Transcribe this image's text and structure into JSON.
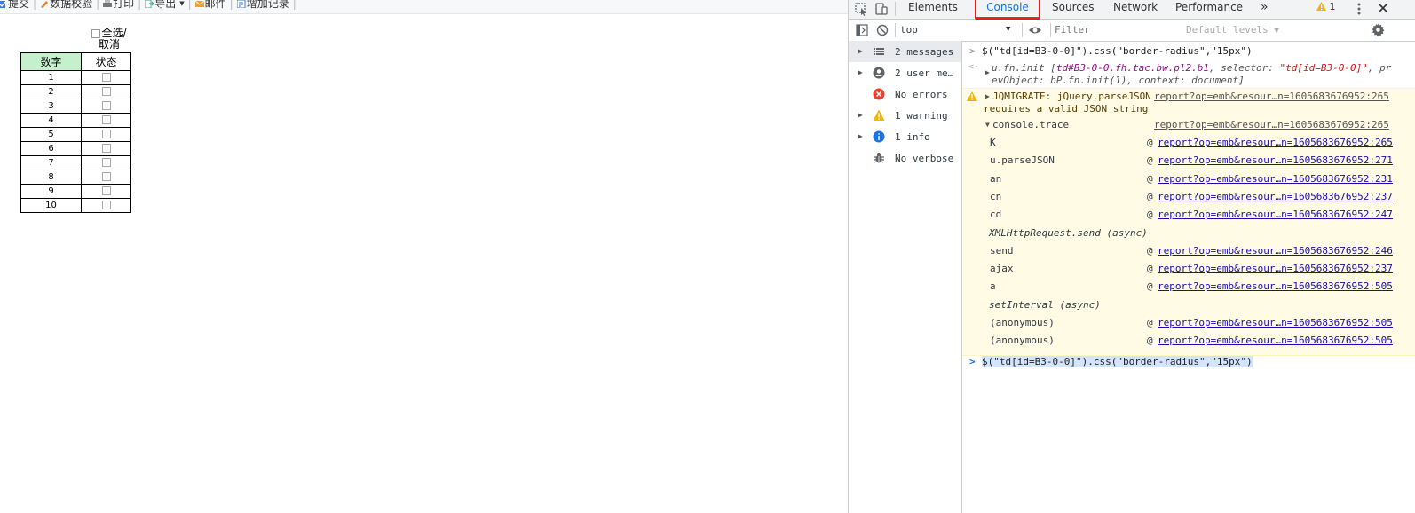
{
  "report": {
    "toolbar": [
      {
        "icon": "submit-icon",
        "label": "提交"
      },
      {
        "icon": "data-check-icon",
        "label": "数据校验"
      },
      {
        "icon": "print-icon",
        "label": "打印"
      },
      {
        "icon": "export-icon",
        "label": "导出"
      },
      {
        "icon": "mail-icon",
        "label": "邮件"
      },
      {
        "icon": "add-record-icon",
        "label": "增加记录"
      }
    ],
    "select_all_line1": "全选/",
    "select_all_line2": "取消",
    "table": {
      "headers": [
        "数字",
        "状态"
      ],
      "rows": [
        "1",
        "2",
        "3",
        "4",
        "5",
        "6",
        "7",
        "8",
        "9",
        "10"
      ]
    },
    "colors": {
      "header_fill": "#c6efce"
    }
  },
  "devtools": {
    "tabs": [
      "Elements",
      "Console",
      "Sources",
      "Network",
      "Performance"
    ],
    "active_tab": "Console",
    "more_tabs_glyph": "»",
    "warning_count": "1",
    "context": "top",
    "filter_placeholder": "Filter",
    "levels": "Default levels",
    "sidebar": [
      {
        "label": "2 messages",
        "icon": "list-icon"
      },
      {
        "label": "2 user me…",
        "icon": "user-icon"
      },
      {
        "label": "No errors",
        "icon": "error-icon"
      },
      {
        "label": "1 warning",
        "icon": "warning-icon"
      },
      {
        "label": "1 info",
        "icon": "info-icon"
      },
      {
        "label": "No verbose",
        "icon": "bug-icon"
      }
    ],
    "log": {
      "cmd1": "$(\"td[id=B3-0-0]\").css(\"border-radius\",\"15px\")",
      "result_line1_a": "u.fn.init [",
      "result_line1_b": "td#B3-0-0.fh.tac.bw.pl2.b1",
      "result_line1_c": ", selector: ",
      "result_line1_d": "\"td[id=B3-0-0]\"",
      "result_line1_e": ", pr",
      "result_line2": "evObject: bP.fn.init(1), context: document]",
      "warn_line1": "JQMIGRATE: jQuery.parseJSON",
      "warn_line2": "requires a valid JSON string",
      "warn_link": "report?op=emb&resour…n=1605683676952:265",
      "trace_label": "console.trace",
      "trace_link": "report?op=emb&resour…n=1605683676952:265",
      "frames": [
        {
          "fn": "K",
          "src": "report?op=emb&resour…n=1605683676952:265",
          "async": false
        },
        {
          "fn": "u.parseJSON",
          "src": "report?op=emb&resour…n=1605683676952:271",
          "async": false
        },
        {
          "fn": "an",
          "src": "report?op=emb&resour…n=1605683676952:231",
          "async": false
        },
        {
          "fn": "cn",
          "src": "report?op=emb&resour…n=1605683676952:237",
          "async": false
        },
        {
          "fn": "cd",
          "src": "report?op=emb&resour…n=1605683676952:247",
          "async": false
        },
        {
          "fn": "XMLHttpRequest.send (async)",
          "src": "",
          "async": true
        },
        {
          "fn": "send",
          "src": "report?op=emb&resour…n=1605683676952:246",
          "async": false
        },
        {
          "fn": "ajax",
          "src": "report?op=emb&resour…n=1605683676952:237",
          "async": false
        },
        {
          "fn": "a",
          "src": "report?op=emb&resour…n=1605683676952:505",
          "async": false
        },
        {
          "fn": "setInterval (async)",
          "src": "",
          "async": true
        },
        {
          "fn": "(anonymous)",
          "src": "report?op=emb&resour…n=1605683676952:505",
          "async": false
        },
        {
          "fn": "(anonymous)",
          "src": "report?op=emb&resour…n=1605683676952:505",
          "async": false
        }
      ],
      "at_sign": "@",
      "prompt_input": "$(\"td[id=B3-0-0]\").css(\"border-radius\",\"15px\")"
    }
  }
}
